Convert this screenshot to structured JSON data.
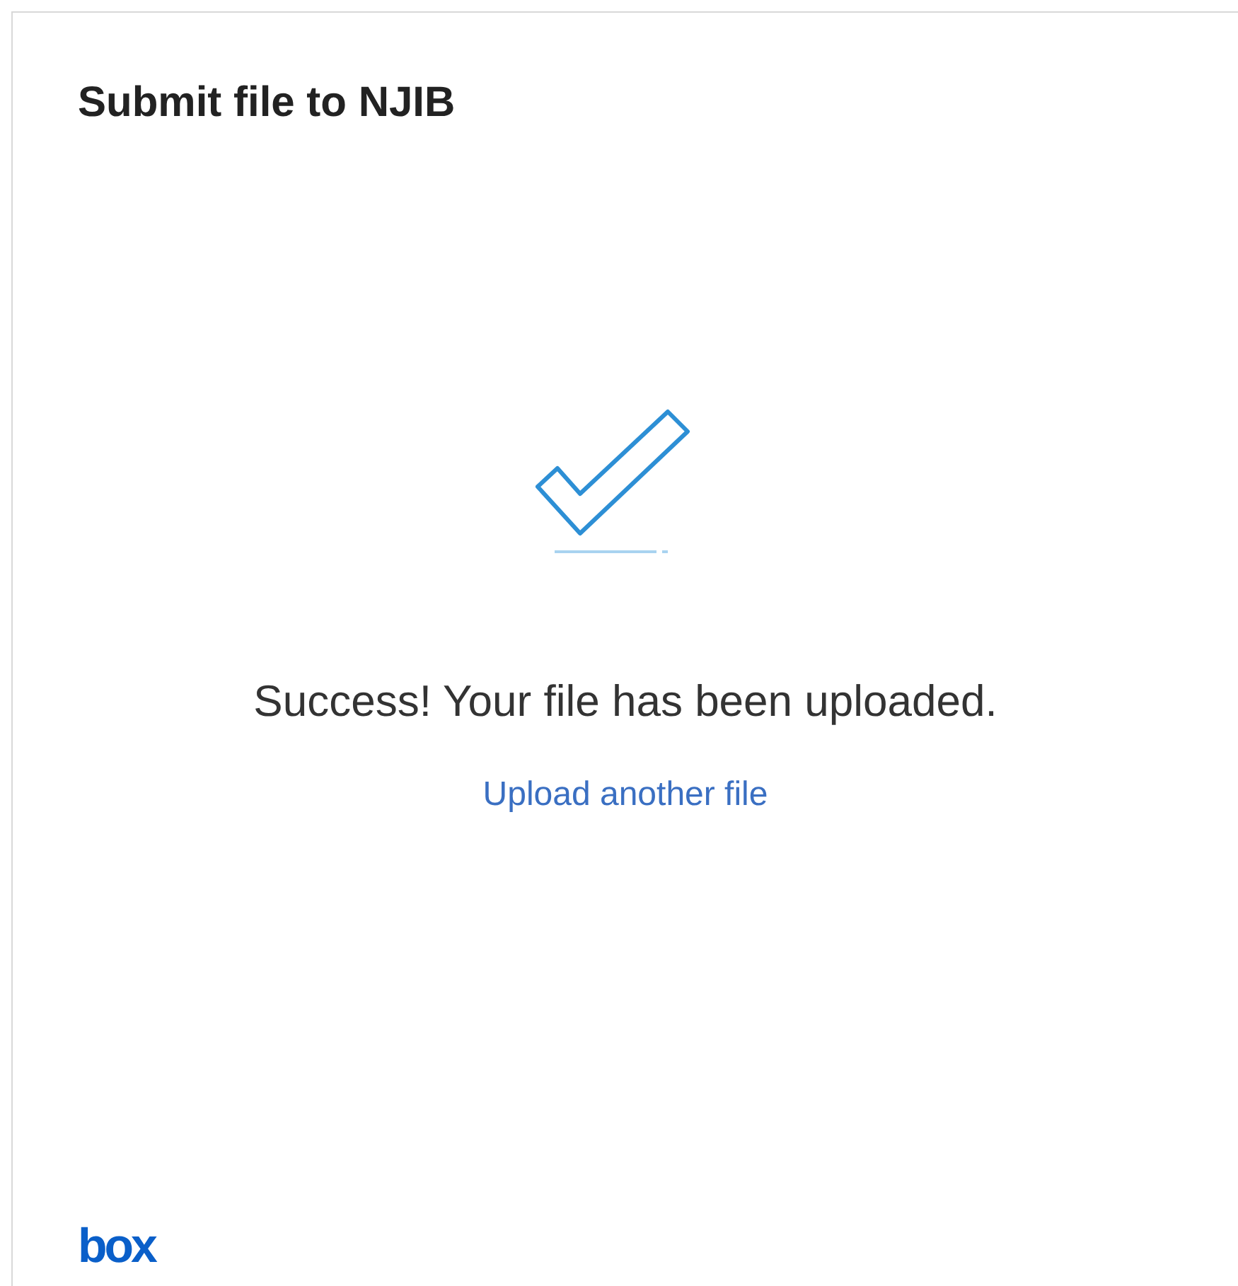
{
  "dialog": {
    "title": "Submit file to NJIB"
  },
  "message": "Success! Your file has been uploaded.",
  "link": "Upload another file",
  "logo": "box"
}
